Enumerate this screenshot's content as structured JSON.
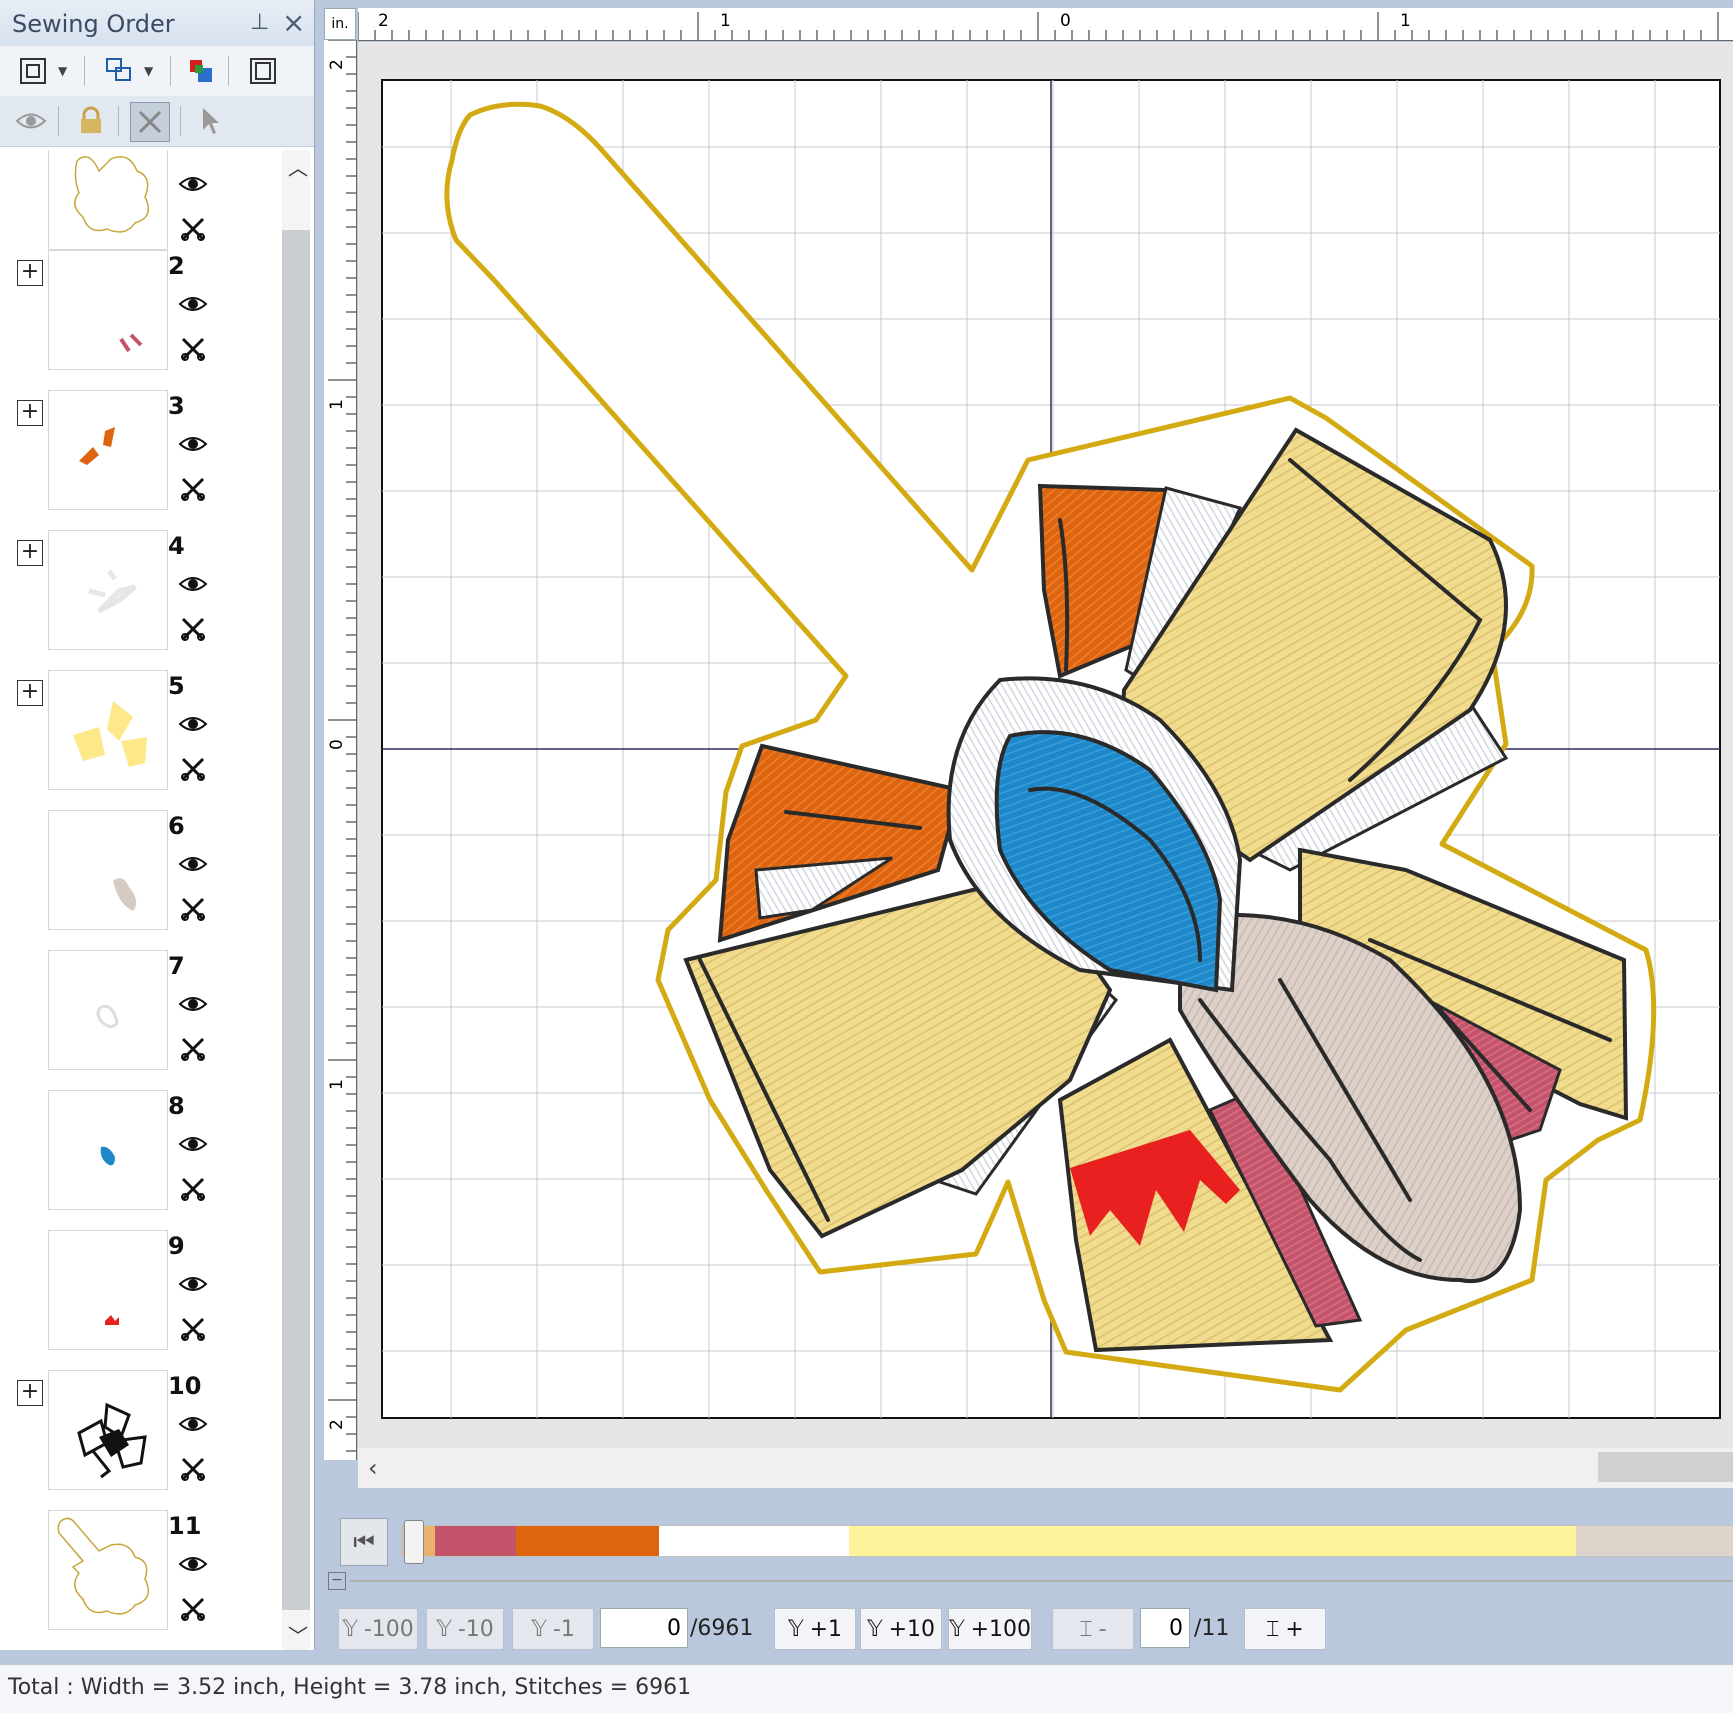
{
  "panel": {
    "title": "Sewing Order",
    "pin_glyph": "⊥",
    "close_glyph": "×",
    "toolbar_icons": [
      "fit-view-icon",
      "group-icon",
      "color-order-icon",
      "hoop-icon"
    ],
    "toolbar2_icons": [
      "visibility-icon",
      "lock-icon",
      "trim-icon",
      "select-arrow-icon"
    ],
    "items": [
      {
        "number": "",
        "has_expand": false,
        "thumb": "outline"
      },
      {
        "number": "2",
        "has_expand": true,
        "thumb": "pink-marks"
      },
      {
        "number": "3",
        "has_expand": true,
        "thumb": "orange-pieces"
      },
      {
        "number": "4",
        "has_expand": true,
        "thumb": "white-pieces"
      },
      {
        "number": "5",
        "has_expand": true,
        "thumb": "yellow-pieces"
      },
      {
        "number": "6",
        "has_expand": false,
        "thumb": "beige-piece"
      },
      {
        "number": "7",
        "has_expand": false,
        "thumb": "white-drop"
      },
      {
        "number": "8",
        "has_expand": false,
        "thumb": "blue-drop"
      },
      {
        "number": "9",
        "has_expand": false,
        "thumb": "red-mark"
      },
      {
        "number": "10",
        "has_expand": true,
        "thumb": "black-outline"
      },
      {
        "number": "11",
        "has_expand": false,
        "thumb": "outline"
      }
    ]
  },
  "rulers": {
    "corner": "in.",
    "h_labels": [
      "2",
      "1",
      "0",
      "1"
    ],
    "v_labels": [
      "2",
      "1",
      "0",
      "1",
      "2"
    ]
  },
  "colorbar": {
    "segments": [
      {
        "color": "#e8b36a",
        "weight": 28
      },
      {
        "color": "#c4546a",
        "weight": 72
      },
      {
        "color": "#dd6510",
        "weight": 126
      },
      {
        "color": "#ffffff",
        "weight": 168
      },
      {
        "color": "#fdf39a",
        "weight": 642
      },
      {
        "color": "#ddd4cc",
        "weight": 140
      }
    ]
  },
  "stitch_controls": {
    "minus100": "-100",
    "minus10": "-10",
    "minus1": "-1",
    "current": "0",
    "total": "/6961",
    "plus1": "+1",
    "plus10": "+10",
    "plus100": "+100",
    "hoop_minus": "-",
    "hoop_current": "0",
    "hoop_total": "/11",
    "hoop_plus": "+"
  },
  "status": {
    "text": "Total : Width = 3.52 inch, Height = 3.78 inch, Stitches = 6961"
  },
  "colors": {
    "gold": "#d4aa12",
    "yellow_fill": "#f0dc8c",
    "orange": "#dd6510",
    "blue": "#1e88c8",
    "pink": "#c4546a",
    "red": "#e82020",
    "beige": "#ddd0c8"
  }
}
